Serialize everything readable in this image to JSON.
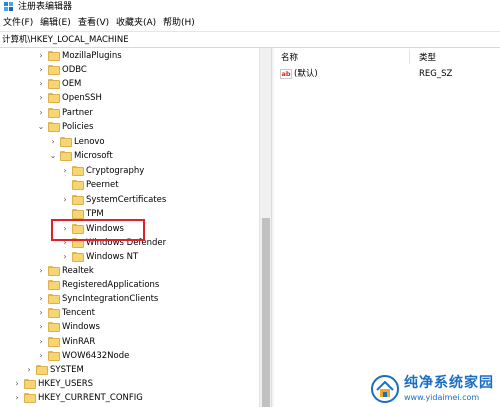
{
  "window": {
    "title": "注册表编辑器"
  },
  "menu": {
    "file": "文件(F)",
    "edit": "编辑(E)",
    "view": "查看(V)",
    "favorites": "收藏夹(A)",
    "help": "帮助(H)"
  },
  "address": {
    "path": "计算机\\HKEY_LOCAL_MACHINE"
  },
  "tree": {
    "items": [
      {
        "label": "MozillaPlugins",
        "chevron": "›"
      },
      {
        "label": "ODBC",
        "chevron": "›"
      },
      {
        "label": "OEM",
        "chevron": "›"
      },
      {
        "label": "OpenSSH",
        "chevron": "›"
      },
      {
        "label": "Partner",
        "chevron": "›"
      },
      {
        "label": "Policies",
        "chevron": "⌄"
      },
      {
        "label": "Lenovo",
        "chevron": "›"
      },
      {
        "label": "Microsoft",
        "chevron": "⌄"
      },
      {
        "label": "Cryptography",
        "chevron": "›"
      },
      {
        "label": "Peernet",
        "chevron": ""
      },
      {
        "label": "SystemCertificates",
        "chevron": "›"
      },
      {
        "label": "TPM",
        "chevron": ""
      },
      {
        "label": "Windows",
        "chevron": "›"
      },
      {
        "label": "Windows Defender",
        "chevron": "›"
      },
      {
        "label": "Windows NT",
        "chevron": "›"
      },
      {
        "label": "Realtek",
        "chevron": "›"
      },
      {
        "label": "RegisteredApplications",
        "chevron": ""
      },
      {
        "label": "SyncIntegrationClients",
        "chevron": "›"
      },
      {
        "label": "Tencent",
        "chevron": "›"
      },
      {
        "label": "Windows",
        "chevron": "›"
      },
      {
        "label": "WinRAR",
        "chevron": "›"
      },
      {
        "label": "WOW6432Node",
        "chevron": "›"
      },
      {
        "label": "SYSTEM",
        "chevron": "›"
      },
      {
        "label": "HKEY_USERS",
        "chevron": "›"
      },
      {
        "label": "HKEY_CURRENT_CONFIG",
        "chevron": "›"
      }
    ]
  },
  "list": {
    "columns": {
      "name": "名称",
      "type": "类型"
    },
    "rows": [
      {
        "name": "(默认)",
        "type": "REG_SZ",
        "icon": "ab"
      }
    ]
  },
  "watermark": {
    "title": "纯净系统家园",
    "url": "www.yidaimei.com"
  },
  "colors": {
    "highlight": "#e0202a",
    "folder": "#f7d574",
    "brand": "#1a6fc4"
  }
}
